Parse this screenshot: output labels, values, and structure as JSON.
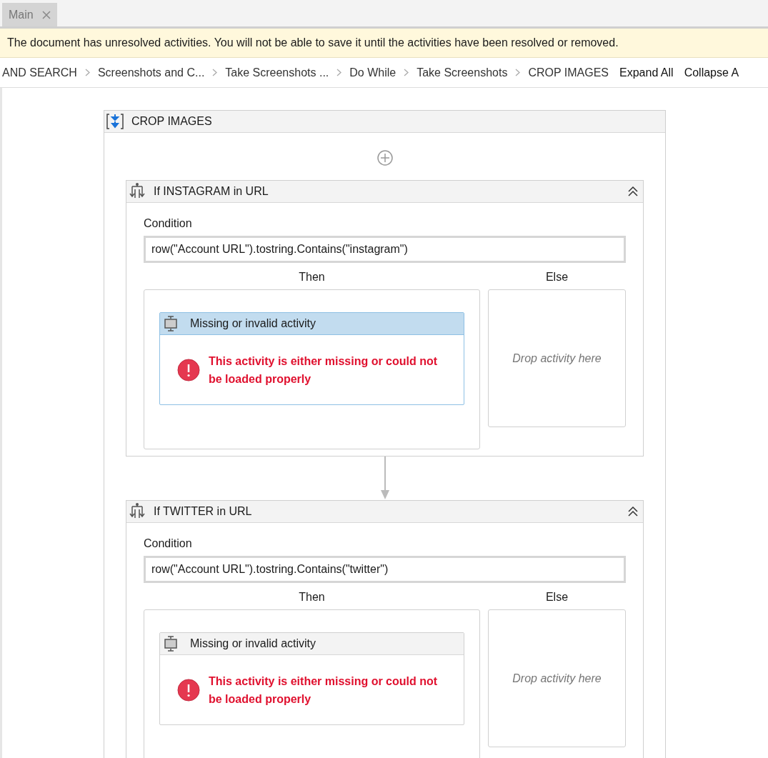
{
  "tabs": [
    {
      "label": "Main",
      "selected": true
    }
  ],
  "warning": "The document has unresolved activities. You will not be able to save it until the activities have been resolved or removed.",
  "breadcrumb": {
    "items": [
      "AND SEARCH",
      "Screenshots and C...",
      "Take Screenshots ...",
      "Do While",
      "Take Screenshots",
      "CROP IMAGES"
    ],
    "actions": [
      "Expand All",
      "Collapse A"
    ]
  },
  "sequence": {
    "title": "CROP IMAGES",
    "activities": [
      {
        "title": "If INSTAGRAM in URL",
        "condition_label": "Condition",
        "condition": "row(\"Account URL\").tostring.Contains(\"instagram\")",
        "then_label": "Then",
        "else_label": "Else",
        "then_activity": {
          "title": "Missing or invalid activity",
          "selected": true,
          "message": "This activity is either missing or could not be loaded properly"
        },
        "else_placeholder": "Drop activity here"
      },
      {
        "title": "If TWITTER in URL",
        "condition_label": "Condition",
        "condition": "row(\"Account URL\").tostring.Contains(\"twitter\")",
        "then_label": "Then",
        "else_label": "Else",
        "then_activity": {
          "title": "Missing or invalid activity",
          "selected": false,
          "message": "This activity is either missing or could not be loaded properly"
        },
        "else_placeholder": "Drop activity here"
      }
    ]
  }
}
